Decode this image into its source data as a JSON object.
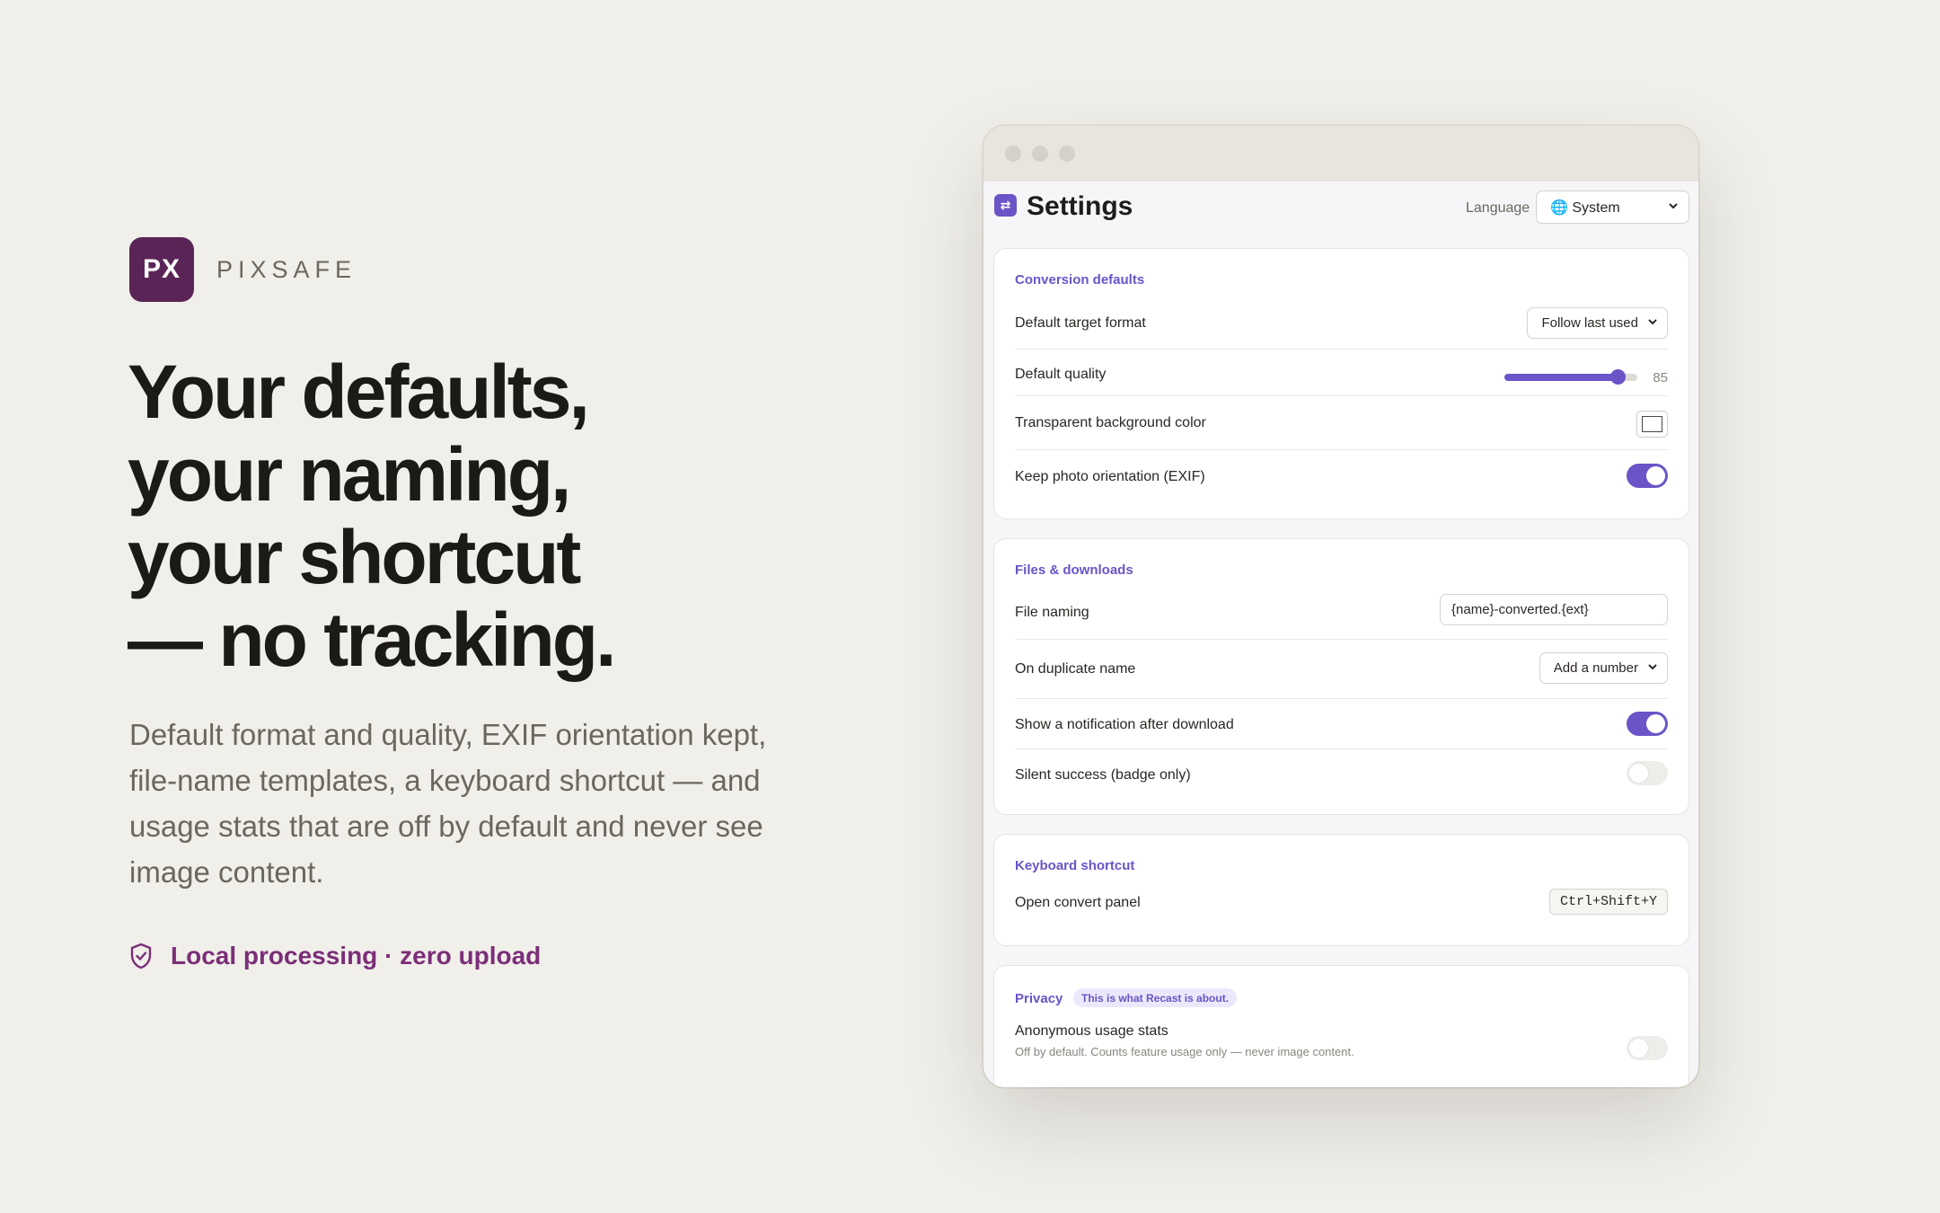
{
  "brand": {
    "logo_text": "PX",
    "name": "PIXSAFE",
    "logo_color": "#5b2456"
  },
  "hero": {
    "headline": [
      "Your defaults,",
      "your naming,",
      "your shortcut",
      "— no tracking."
    ],
    "subcopy": "Default format and quality, EXIF orientation kept, file-name templates, a keyboard shortcut — and usage stats that are off by default and never see image content.",
    "trust_text": "Local processing · zero upload",
    "trust_icon": "shield-check-icon",
    "accent": "#7b2e78"
  },
  "window": {
    "title": "Settings",
    "app_icon": "swap-arrows-icon",
    "language_label": "Language",
    "language_value": "🌐 System",
    "accent": "#6a54c7"
  },
  "conversion": {
    "title": "Conversion defaults",
    "target_format_label": "Default target format",
    "target_format_value": "Follow last used",
    "quality_label": "Default quality",
    "quality_value": "85",
    "quality_fraction": 0.85,
    "bg_color_label": "Transparent background color",
    "bg_color_value": "#ffffff",
    "orientation_label": "Keep photo orientation (EXIF)",
    "orientation_on": true
  },
  "files": {
    "title": "Files & downloads",
    "naming_label": "File naming",
    "naming_value": "{name}-converted.{ext}",
    "duplicate_label": "On duplicate name",
    "duplicate_value": "Add a number",
    "notify_label": "Show a notification after download",
    "notify_on": true,
    "silent_label": "Silent success (badge only)",
    "silent_on": false
  },
  "shortcut": {
    "title": "Keyboard shortcut",
    "open_label": "Open convert panel",
    "open_value": "Ctrl+Shift+Y"
  },
  "privacy": {
    "title": "Privacy",
    "badge": "This is what Recast is about.",
    "stats_label": "Anonymous usage stats",
    "stats_desc": "Off by default. Counts feature usage only — never image content.",
    "stats_on": false
  }
}
